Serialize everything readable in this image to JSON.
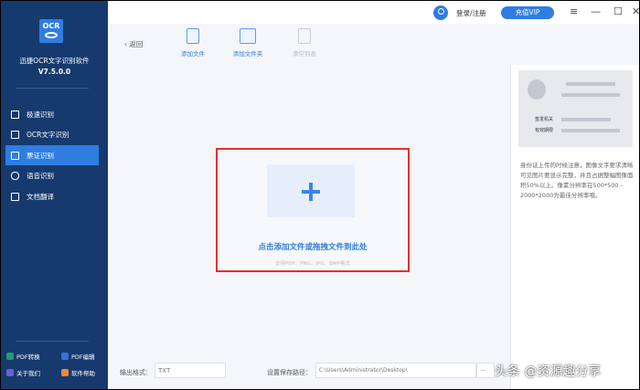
{
  "sidebar": {
    "logo": "OCR",
    "app_name": "迅捷OCR文字识别软件",
    "version": "V7.5.0.0",
    "items": [
      {
        "label": "极速识别"
      },
      {
        "label": "OCR文字识别"
      },
      {
        "label": "票证识别",
        "active": true
      },
      {
        "label": "语音识别"
      },
      {
        "label": "文档翻译"
      }
    ],
    "footer": [
      {
        "label": "PDF转换",
        "color": "#1f9d6b"
      },
      {
        "label": "PDF编辑",
        "color": "#3b6fe0"
      },
      {
        "label": "关于我们",
        "color": "#6b5fd8"
      },
      {
        "label": "软件帮助",
        "color": "#f08a2c"
      }
    ]
  },
  "header": {
    "login": "登录/注册",
    "vip": "充值VIP",
    "menu": "≡",
    "minimize": "—",
    "maximize": "☐",
    "close": "✕"
  },
  "toolbar": {
    "back": "返回",
    "add_file": "添加文件",
    "add_folder": "添加文件夹",
    "clear_list": "清空列表"
  },
  "dropzone": {
    "title": "点击添加文件或拖拽文件到此处",
    "subtitle": "支持PDF、PNG、JPG、BMP格式"
  },
  "right_panel": {
    "field1": "签发机关",
    "field2": "有效期限",
    "tip": "身份证上传的时候注意，图像文字要求清晰可见图片要显示完整，并且占据整幅图像面积50%以上。像素分辨率在500*500 - 2000*2000为最佳分辨率哦。"
  },
  "bottom": {
    "format_label": "输出格式：",
    "format_value": "TXT",
    "path_label": "设置保存路径：",
    "path_value": "C:\\Users\\Administrator\\Desktop\\",
    "browse": "···"
  },
  "watermark": "头条 @资源趣分享"
}
